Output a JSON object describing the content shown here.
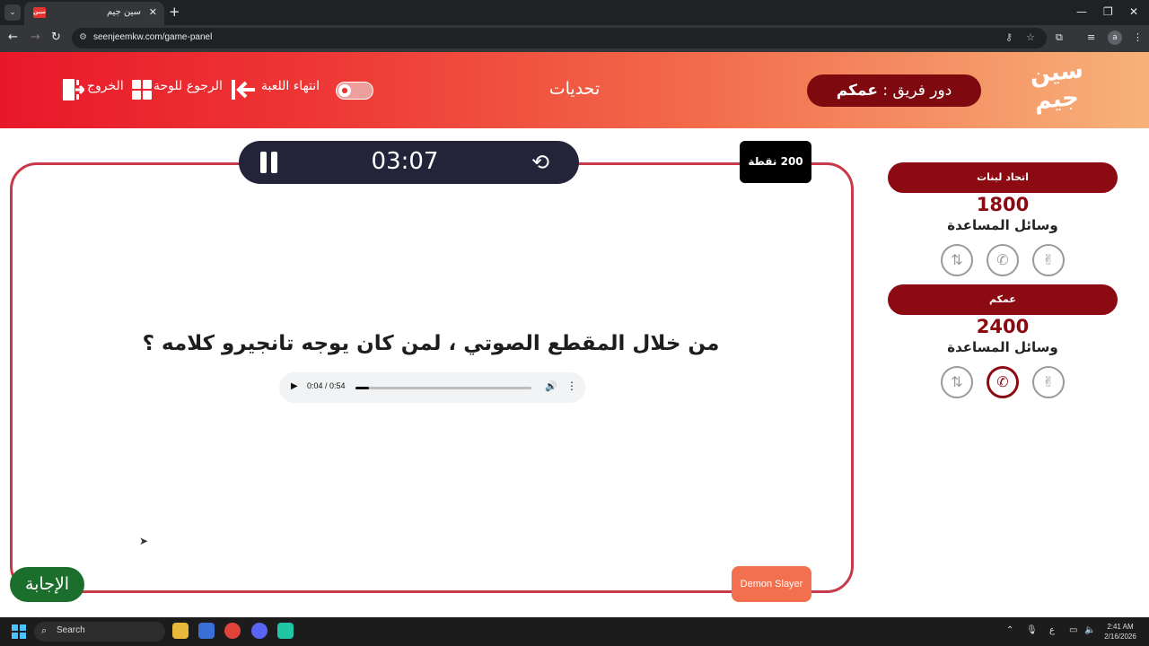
{
  "browser": {
    "tab_title": "سين جيم",
    "tab_favicon_text": "سين",
    "url": "seenjeemkw.com/game-panel",
    "new_tab": "+",
    "close": "✕"
  },
  "header": {
    "logo_line1": "سين",
    "logo_line2": "جيم",
    "turn_prefix": "دور فريق : ",
    "turn_team": "عمكم",
    "title": "تحديات",
    "end_game": "انتهاء اللعبة",
    "back_to_board": "الرجوع للوحة",
    "exit": "الخروج"
  },
  "teams": [
    {
      "name": "اتحاد لبنات",
      "score": "1800",
      "aids_label": "وسائل المساعدة",
      "aids_used": [
        false,
        false,
        false
      ]
    },
    {
      "name": "عمكم",
      "score": "2400",
      "aids_label": "وسائل المساعدة",
      "aids_used": [
        false,
        true,
        false
      ]
    }
  ],
  "question": {
    "timer": "03:07",
    "points": "200 نقطة",
    "text": "من خلال المقطع الصوتي ، لمن كان يوجه تانجيرو كلامه ؟",
    "audio_time": "0:04 / 0:54",
    "audio_progress": 0.074,
    "category": "Demon Slayer",
    "answer_button": "الإجابة"
  },
  "taskbar": {
    "search_label": "Search",
    "time": "2:41 AM",
    "date": "2/16/2026",
    "lang": "ع"
  },
  "colors": {
    "accent_red": "#8c0b12",
    "header_start": "#e8182a",
    "header_end": "#f7b27a",
    "answer_green": "#1c6e2c",
    "category_orange": "#f2704e"
  }
}
